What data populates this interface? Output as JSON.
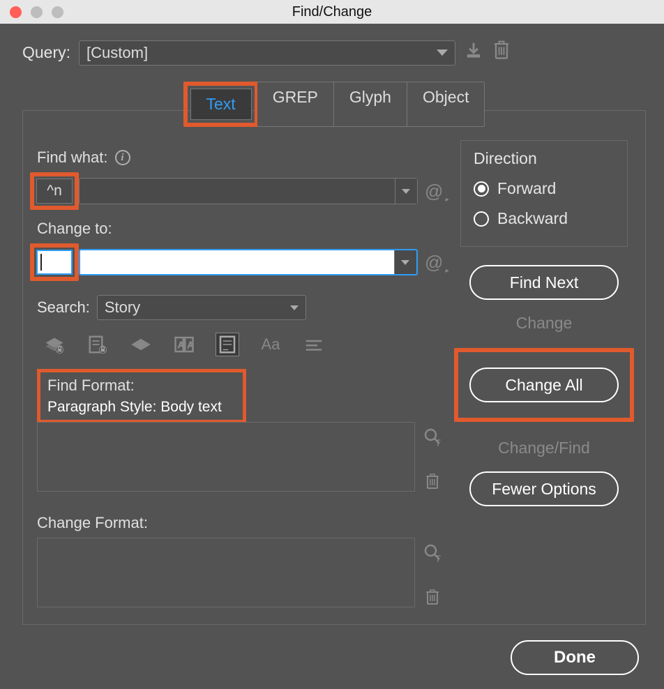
{
  "window": {
    "title": "Find/Change"
  },
  "query": {
    "label": "Query:",
    "value": "[Custom]"
  },
  "tabs": {
    "text": "Text",
    "grep": "GREP",
    "glyph": "Glyph",
    "object": "Object"
  },
  "find_what": {
    "label": "Find what:",
    "value": "^n"
  },
  "change_to": {
    "label": "Change to:",
    "value": ""
  },
  "search": {
    "label": "Search:",
    "value": "Story"
  },
  "icons": {
    "save": "save-query-icon",
    "trash": "trash-icon",
    "info": "info-icon",
    "special": "special-chars-icon",
    "layers_lock": "locked-layers-icon",
    "story_lock": "locked-stories-icon",
    "hidden": "hidden-layers-icon",
    "master": "master-pages-icon",
    "footnotes": "footnotes-icon",
    "case": "case-sensitive-icon",
    "whole_word": "whole-word-icon",
    "search_fmt": "specify-format-icon",
    "clear_fmt": "clear-format-icon"
  },
  "toolbar_labels": {
    "case": "Aa"
  },
  "find_format": {
    "label": "Find Format:",
    "value": "Paragraph Style: Body text"
  },
  "change_format": {
    "label": "Change Format:"
  },
  "direction": {
    "title": "Direction",
    "forward": "Forward",
    "backward": "Backward"
  },
  "buttons": {
    "find_next": "Find Next",
    "change": "Change",
    "change_all": "Change All",
    "change_find": "Change/Find",
    "fewer_options": "Fewer Options",
    "done": "Done"
  }
}
